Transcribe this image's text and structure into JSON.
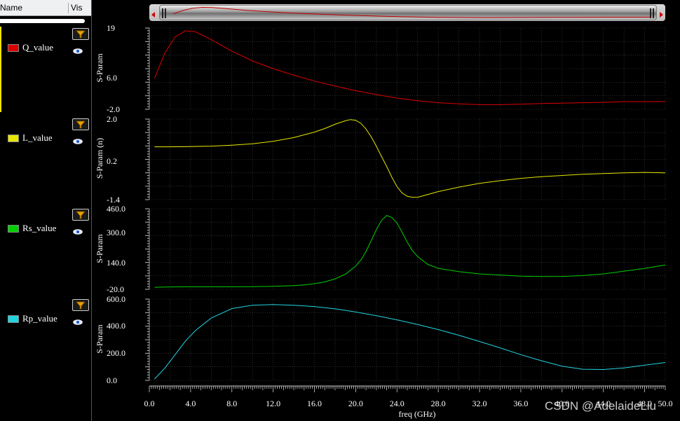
{
  "legend": {
    "header_name": "Name",
    "header_vis": "Vis",
    "items": [
      {
        "label": "Q_value",
        "color": "#dd0000"
      },
      {
        "label": "L_value",
        "color": "#e6e600"
      },
      {
        "label": "Rs_value",
        "color": "#00d000"
      },
      {
        "label": "Rp_value",
        "color": "#22d4e0"
      }
    ],
    "icons": {
      "filter": "filter-funnel-icon",
      "visibility": "eye-icon"
    }
  },
  "scrollbar": {
    "left_arrow": "left-arrow-icon",
    "right_arrow": "right-arrow-icon",
    "grip": "grip-icon"
  },
  "watermark": "CSDN @AdelaideLiu",
  "chart_data": [
    {
      "type": "line",
      "series": [
        {
          "name": "Q_value",
          "color": "#dd0000",
          "x": [
            0.5,
            1.5,
            2.5,
            3.5,
            4.5,
            6,
            8,
            10,
            12,
            14,
            16,
            18,
            20,
            22,
            24,
            26,
            28,
            30,
            32,
            34,
            36,
            38,
            40,
            42,
            44,
            46,
            48,
            50
          ],
          "y": [
            6.0,
            12.5,
            16.7,
            18.3,
            18.0,
            16.0,
            13.0,
            10.5,
            8.5,
            6.8,
            5.3,
            4.0,
            2.8,
            1.8,
            0.9,
            0.2,
            -0.3,
            -0.6,
            -0.8,
            -0.8,
            -0.7,
            -0.5,
            -0.4,
            -0.3,
            -0.2,
            0.0,
            0.0,
            0.0
          ]
        }
      ],
      "ylabel": "S-Param",
      "ylim": [
        -2.0,
        19
      ],
      "yticks": [
        "19",
        "6.0",
        "-2.0"
      ],
      "ytick_values": [
        19,
        6.0,
        -2.0
      ]
    },
    {
      "type": "line",
      "series": [
        {
          "name": "L_value",
          "color": "#e6e600",
          "x": [
            0.5,
            2,
            4,
            6,
            8,
            10,
            12,
            14,
            16,
            17,
            18,
            19,
            19.5,
            20,
            20.5,
            21,
            21.5,
            22,
            22.5,
            23,
            23.5,
            24,
            24.5,
            25,
            25.5,
            26,
            27,
            28,
            30,
            32,
            34,
            36,
            38,
            40,
            42,
            44,
            46,
            48,
            50
          ],
          "y": [
            0.83,
            0.83,
            0.84,
            0.86,
            0.9,
            0.96,
            1.06,
            1.22,
            1.45,
            1.6,
            1.78,
            1.93,
            1.98,
            1.95,
            1.82,
            1.58,
            1.25,
            0.86,
            0.42,
            0.0,
            -0.45,
            -0.85,
            -1.12,
            -1.26,
            -1.3,
            -1.3,
            -1.18,
            -1.06,
            -0.87,
            -0.71,
            -0.6,
            -0.5,
            -0.43,
            -0.38,
            -0.33,
            -0.3,
            -0.27,
            -0.25,
            -0.27
          ]
        }
      ],
      "ylabel": "S-Param (n)",
      "ylim": [
        -1.4,
        2.0
      ],
      "yticks": [
        "2.0",
        "0.2",
        "-1.4"
      ],
      "ytick_values": [
        2.0,
        0.2,
        -1.4
      ]
    },
    {
      "type": "line",
      "series": [
        {
          "name": "Rs_value",
          "color": "#00d000",
          "x": [
            0.5,
            2,
            4,
            6,
            8,
            10,
            12,
            14,
            15,
            16,
            17,
            18,
            19,
            20,
            20.5,
            21,
            21.5,
            22,
            22.5,
            23,
            23.5,
            24,
            24.5,
            25,
            25.5,
            26,
            27,
            28,
            30,
            32,
            34,
            36,
            38,
            40,
            42,
            44,
            46,
            48,
            50
          ],
          "y": [
            -8,
            -6,
            -5,
            -5,
            -5,
            -4,
            -2,
            2,
            6,
            14,
            24,
            42,
            70,
            118,
            155,
            205,
            270,
            335,
            390,
            420,
            408,
            375,
            320,
            260,
            210,
            175,
            128,
            105,
            85,
            72,
            65,
            58,
            56,
            57,
            62,
            72,
            88,
            105,
            125
          ]
        }
      ],
      "ylabel": "S-Param",
      "ylim": [
        -20.0,
        460.0
      ],
      "yticks": [
        "460.0",
        "300.0",
        "140.0",
        "-20.0"
      ],
      "ytick_values": [
        460.0,
        300.0,
        140.0,
        -20.0
      ]
    },
    {
      "type": "line",
      "series": [
        {
          "name": "Rp_value",
          "color": "#22d4e0",
          "x": [
            0.5,
            1.5,
            2.5,
            3.5,
            4.5,
            6,
            8,
            10,
            12,
            14,
            16,
            18,
            20,
            22,
            24,
            26,
            28,
            30,
            32,
            34,
            36,
            38,
            40,
            42,
            44,
            46,
            48,
            50
          ],
          "y": [
            10,
            90,
            190,
            290,
            370,
            460,
            530,
            555,
            560,
            555,
            545,
            528,
            505,
            478,
            447,
            413,
            375,
            333,
            287,
            240,
            190,
            145,
            105,
            82,
            80,
            92,
            112,
            132
          ]
        }
      ],
      "ylabel": "S-Param",
      "xlabel": "freq (GHz)",
      "ylim": [
        0.0,
        600.0
      ],
      "yticks": [
        "600.0",
        "400.0",
        "200.0",
        "0.0"
      ],
      "ytick_values": [
        600.0,
        400.0,
        200.0,
        0.0
      ],
      "xlim": [
        0.0,
        50.0
      ],
      "xticks": [
        "0.0",
        "4.0",
        "8.0",
        "12.0",
        "16.0",
        "20.0",
        "24.0",
        "28.0",
        "32.0",
        "36.0",
        "40.0",
        "44.0",
        "48.0",
        "50.0"
      ],
      "xtick_values": [
        0,
        4,
        8,
        12,
        16,
        20,
        24,
        28,
        32,
        36,
        40,
        44,
        48,
        50
      ],
      "grid": true
    }
  ]
}
